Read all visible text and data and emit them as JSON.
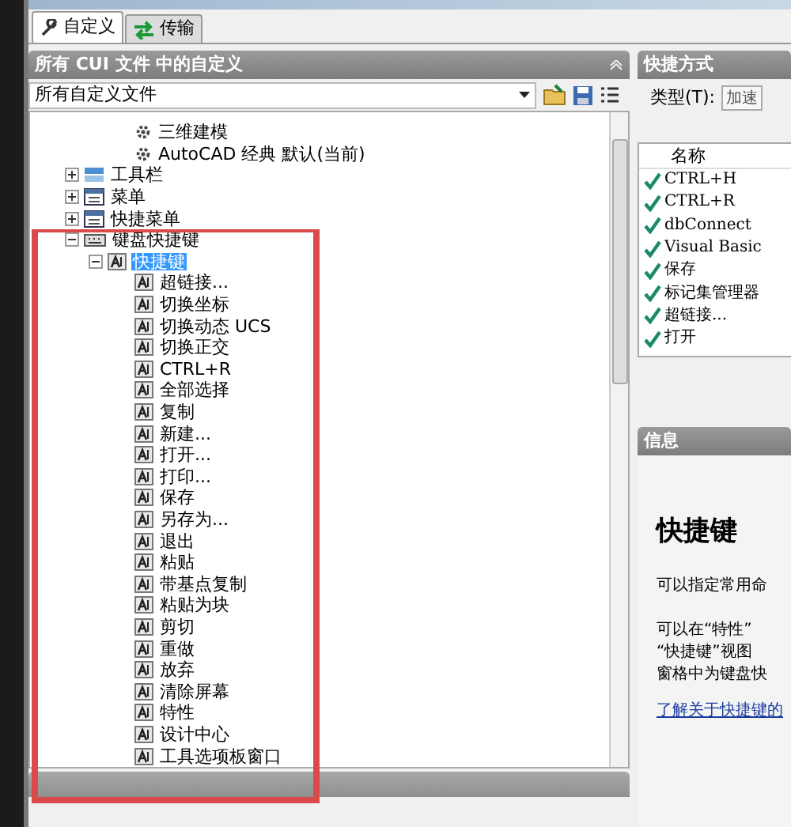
{
  "tabs": [
    {
      "label": "自定义",
      "selected": true
    },
    {
      "label": "传输",
      "selected": false
    }
  ],
  "customizations_panel": {
    "title": "所有 CUI 文件 中的自定义",
    "file_select": {
      "value": "所有自定义文件"
    },
    "tree": {
      "continued": [
        {
          "label": "三维建模",
          "kind": "workspace"
        },
        {
          "label": "AutoCAD 经典 默认(当前)",
          "kind": "workspace"
        }
      ],
      "items": [
        {
          "label": "工具栏",
          "kind": "toolbars",
          "expanded": false,
          "selected": false
        },
        {
          "label": "菜单",
          "kind": "menus",
          "expanded": false,
          "selected": false
        },
        {
          "label": "快捷菜单",
          "kind": "menus",
          "expanded": false,
          "selected": false
        },
        {
          "label": "键盘快捷键",
          "kind": "keyboard",
          "expanded": true,
          "selected": false,
          "children": [
            {
              "label": "快捷键",
              "kind": "shortcut",
              "expanded": true,
              "selected": true,
              "children": [
                {
                  "label": "超链接...",
                  "kind": "shortcut",
                  "selected": false
                },
                {
                  "label": "切换坐标",
                  "kind": "shortcut",
                  "selected": false
                },
                {
                  "label": "切换动态 UCS",
                  "kind": "shortcut",
                  "selected": false
                },
                {
                  "label": "切换正交",
                  "kind": "shortcut",
                  "selected": false
                },
                {
                  "label": "CTRL+R",
                  "kind": "shortcut",
                  "selected": false
                },
                {
                  "label": "全部选择",
                  "kind": "shortcut",
                  "selected": false
                },
                {
                  "label": "复制",
                  "kind": "shortcut",
                  "selected": false
                },
                {
                  "label": "新建...",
                  "kind": "shortcut",
                  "selected": false
                },
                {
                  "label": "打开...",
                  "kind": "shortcut",
                  "selected": false
                },
                {
                  "label": "打印...",
                  "kind": "shortcut",
                  "selected": false
                },
                {
                  "label": "保存",
                  "kind": "shortcut",
                  "selected": false
                },
                {
                  "label": "另存为...",
                  "kind": "shortcut",
                  "selected": false
                },
                {
                  "label": "退出",
                  "kind": "shortcut",
                  "selected": false
                },
                {
                  "label": "粘贴",
                  "kind": "shortcut",
                  "selected": false
                },
                {
                  "label": "带基点复制",
                  "kind": "shortcut",
                  "selected": false
                },
                {
                  "label": "粘贴为块",
                  "kind": "shortcut",
                  "selected": false
                },
                {
                  "label": "剪切",
                  "kind": "shortcut",
                  "selected": false
                },
                {
                  "label": "重做",
                  "kind": "shortcut",
                  "selected": false
                },
                {
                  "label": "放弃",
                  "kind": "shortcut",
                  "selected": false
                },
                {
                  "label": "清除屏幕",
                  "kind": "shortcut",
                  "selected": false
                },
                {
                  "label": "特性",
                  "kind": "shortcut",
                  "selected": false
                },
                {
                  "label": "设计中心",
                  "kind": "shortcut",
                  "selected": false
                },
                {
                  "label": "工具选项板窗口",
                  "kind": "shortcut",
                  "selected": false
                }
              ]
            }
          ]
        }
      ]
    }
  },
  "shortcuts_panel": {
    "title": "快捷方式",
    "type_label": "类型(T):",
    "type_value": "加速",
    "column": "名称",
    "rows": [
      "CTRL+H",
      "CTRL+R",
      "dbConnect",
      "Visual Basic",
      "保存",
      "标记集管理器",
      "超链接...",
      "打开"
    ]
  },
  "info_panel": {
    "title": "信息",
    "heading": "快捷键",
    "lines": [
      "可以指定常用命",
      "可以在“特性”",
      "“快捷键”视图",
      "窗格中为键盘快"
    ],
    "link": "了解关于快捷键的"
  }
}
